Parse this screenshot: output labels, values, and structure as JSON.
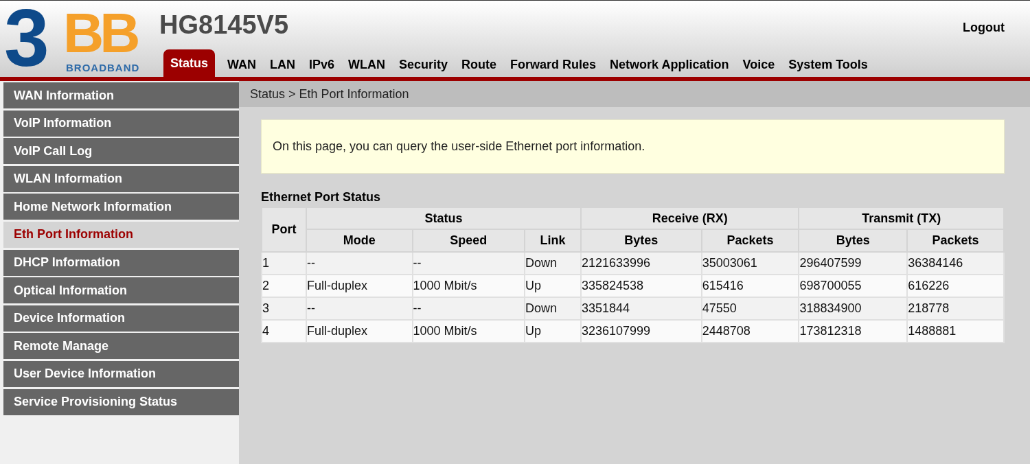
{
  "logo": {
    "numeral": "3",
    "letters": "BB",
    "tagline": "BROADBAND"
  },
  "model": "HG8145V5",
  "logout": "Logout",
  "tabs": [
    {
      "label": "Status",
      "selected": true
    },
    {
      "label": "WAN",
      "selected": false
    },
    {
      "label": "LAN",
      "selected": false
    },
    {
      "label": "IPv6",
      "selected": false
    },
    {
      "label": "WLAN",
      "selected": false
    },
    {
      "label": "Security",
      "selected": false
    },
    {
      "label": "Route",
      "selected": false
    },
    {
      "label": "Forward Rules",
      "selected": false
    },
    {
      "label": "Network Application",
      "selected": false
    },
    {
      "label": "Voice",
      "selected": false
    },
    {
      "label": "System Tools",
      "selected": false
    }
  ],
  "sidebar": {
    "items": [
      {
        "label": "WAN Information",
        "selected": false
      },
      {
        "label": "VoIP Information",
        "selected": false
      },
      {
        "label": "VoIP Call Log",
        "selected": false
      },
      {
        "label": "WLAN Information",
        "selected": false
      },
      {
        "label": "Home Network Information",
        "selected": false
      },
      {
        "label": "Eth Port Information",
        "selected": true
      },
      {
        "label": "DHCP Information",
        "selected": false
      },
      {
        "label": "Optical Information",
        "selected": false
      },
      {
        "label": "Device Information",
        "selected": false
      },
      {
        "label": "Remote Manage",
        "selected": false
      },
      {
        "label": "User Device Information",
        "selected": false
      },
      {
        "label": "Service Provisioning Status",
        "selected": false
      }
    ]
  },
  "breadcrumb": "Status > Eth Port Information",
  "notice": "On this page, you can query the user-side Ethernet port information.",
  "table": {
    "title": "Ethernet Port Status",
    "group_headers": [
      "Port",
      "Status",
      "Receive (RX)",
      "Transmit (TX)"
    ],
    "columns": [
      "",
      "Mode",
      "Speed",
      "Link",
      "Bytes",
      "Packets",
      "Bytes",
      "Packets"
    ],
    "rows": [
      [
        "1",
        "--",
        "--",
        "Down",
        "2121633996",
        "35003061",
        "296407599",
        "36384146"
      ],
      [
        "2",
        "Full-duplex",
        "1000 Mbit/s",
        "Up",
        "335824538",
        "615416",
        "698700055",
        "616226"
      ],
      [
        "3",
        "--",
        "--",
        "Down",
        "3351844",
        "47550",
        "318834900",
        "218778"
      ],
      [
        "4",
        "Full-duplex",
        "1000 Mbit/s",
        "Up",
        "3236107999",
        "2448708",
        "173812318",
        "1488881"
      ]
    ]
  }
}
